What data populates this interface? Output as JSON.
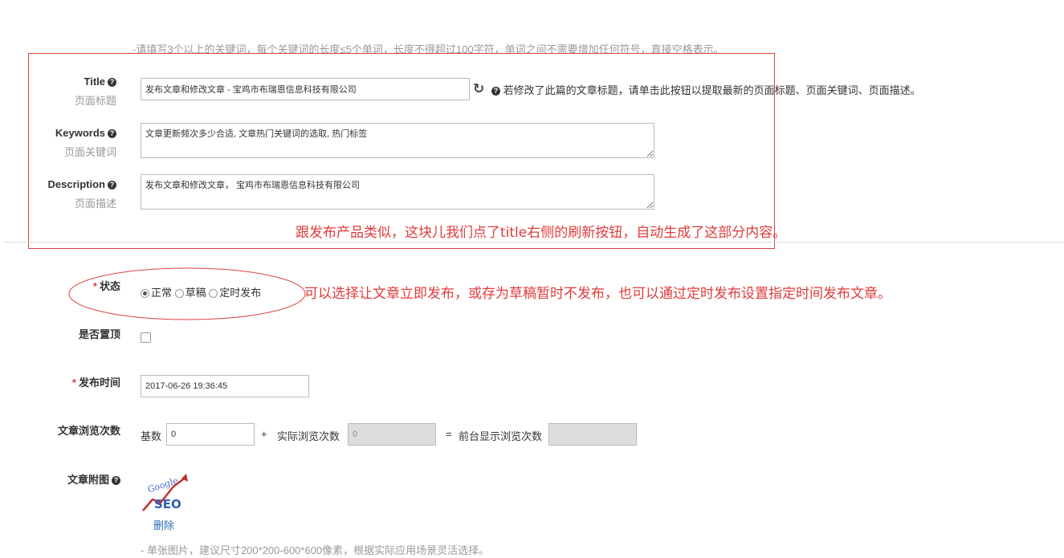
{
  "keyword_hint": "-请填写3个以上的关键词，每个关键词的长度≤5个单词，长度不得超过100字符，单词之间不需要增加任何符号，直接空格表示。",
  "seo": {
    "title": {
      "label": "Title",
      "sublabel": "页面标题",
      "value": "发布文章和修改文章 - 宝鸡市布瑞恩信息科技有限公司",
      "refresh_hint": "若修改了此篇的文章标题，请单击此按钮以提取最新的页面标题、页面关键词、页面描述。"
    },
    "keywords": {
      "label": "Keywords",
      "sublabel": "页面关键词",
      "value": "文章更新频次多少合适, 文章热门关键词的选取, 热门标签"
    },
    "description": {
      "label": "Description",
      "sublabel": "页面描述",
      "value": "发布文章和修改文章， 宝鸡市布瑞恩信息科技有限公司"
    }
  },
  "annotation_seo": "跟发布产品类似，这块儿我们点了title右侧的刷新按钮，自动生成了这部分内容。",
  "status": {
    "label": "状态",
    "options": [
      "正常",
      "草稿",
      "定时发布"
    ],
    "selected": "正常"
  },
  "annotation_status": "可以选择让文章立即发布，或存为草稿暂时不发布，也可以通过定时发布设置指定时间发布文章。",
  "top": {
    "label": "是否置顶"
  },
  "publish_time": {
    "label": "发布时间",
    "value": "2017-06-26 19:36:45"
  },
  "views": {
    "label": "文章浏览次数",
    "base_label": "基数",
    "base_value": "0",
    "plus": "+",
    "actual_label": "实际浏览次数",
    "actual_value": "0",
    "equals": "=",
    "display_label": "前台显示浏览次数",
    "display_value": ""
  },
  "attachment": {
    "label": "文章附图",
    "image_text": "SEO",
    "image_brand": "Google",
    "delete_label": "删除",
    "hint": "- 单张图片，建议尺寸200*200-600*600像素，根据实际应用场景灵活选择。"
  },
  "colors": {
    "annotation": "#e03b3b",
    "link": "#2a6ebb"
  }
}
